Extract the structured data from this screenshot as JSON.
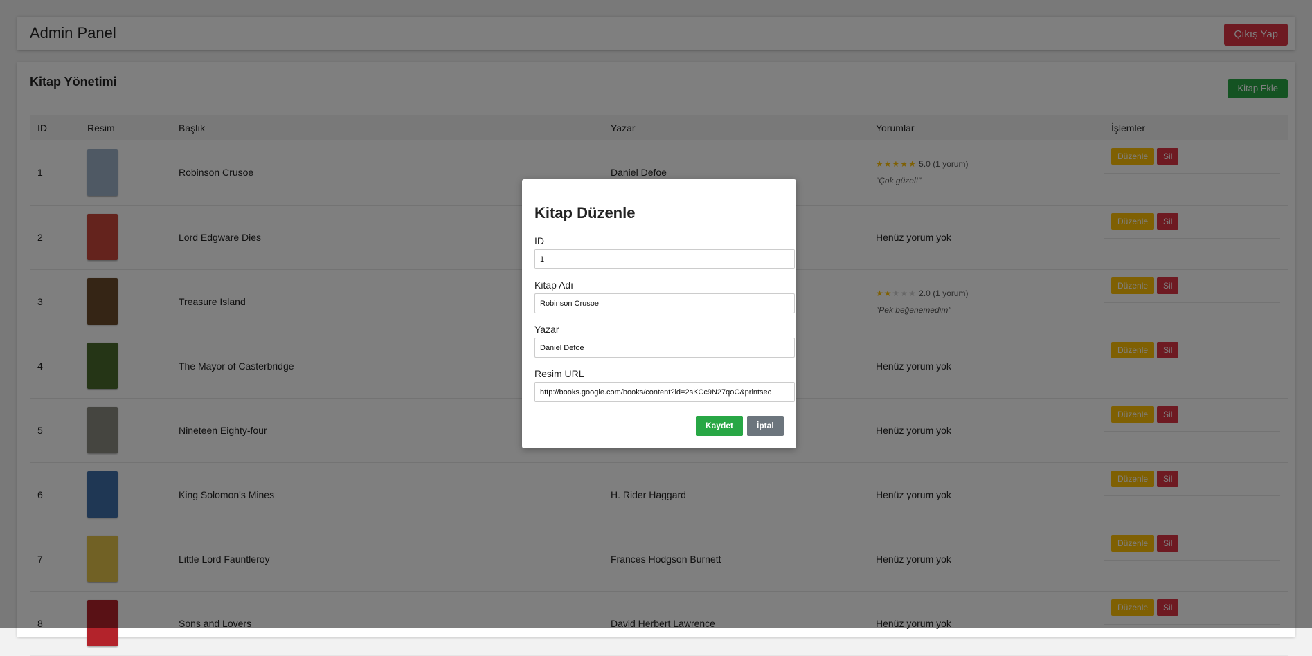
{
  "header": {
    "title": "Admin Panel",
    "logout_label": "Çıkış Yap"
  },
  "panel": {
    "title": "Kitap Yönetimi",
    "add_label": "Kitap Ekle",
    "columns": [
      "ID",
      "Resim",
      "Başlık",
      "Yazar",
      "Yorumlar",
      "İşlemler"
    ],
    "edit_label": "Düzenle",
    "delete_label": "Sil",
    "rows": [
      {
        "id": "1",
        "title": "Robinson Crusoe",
        "author": "Daniel Defoe",
        "rating": 5,
        "rating_text": "5.0 (1 yorum)",
        "comment": "\"Çok güzel!\"",
        "no_comment": "",
        "cover_color": "#9fb3c8"
      },
      {
        "id": "2",
        "title": "Lord Edgware Dies",
        "author": "",
        "rating": 0,
        "rating_text": "",
        "comment": "",
        "no_comment": "Henüz yorum yok",
        "cover_color": "#c9463a"
      },
      {
        "id": "3",
        "title": "Treasure Island",
        "author": "",
        "rating": 2,
        "rating_text": "2.0 (1 yorum)",
        "comment": "\"Pek beğenemedim\"",
        "no_comment": "",
        "cover_color": "#6b4b2a"
      },
      {
        "id": "4",
        "title": "The Mayor of Casterbridge",
        "author": "",
        "rating": 0,
        "rating_text": "",
        "comment": "",
        "no_comment": "Henüz yorum yok",
        "cover_color": "#4a6b2d"
      },
      {
        "id": "5",
        "title": "Nineteen Eighty-four",
        "author": "",
        "rating": 0,
        "rating_text": "",
        "comment": "",
        "no_comment": "Henüz yorum yok",
        "cover_color": "#8a8a80"
      },
      {
        "id": "6",
        "title": "King Solomon's Mines",
        "author": "H. Rider Haggard",
        "rating": 0,
        "rating_text": "",
        "comment": "",
        "no_comment": "Henüz yorum yok",
        "cover_color": "#3f6ea8"
      },
      {
        "id": "7",
        "title": "Little Lord Fauntleroy",
        "author": "Frances Hodgson Burnett",
        "rating": 0,
        "rating_text": "",
        "comment": "",
        "no_comment": "Henüz yorum yok",
        "cover_color": "#e2c24a"
      },
      {
        "id": "8",
        "title": "Sons and Lovers",
        "author": "David Herbert Lawrence",
        "rating": 0,
        "rating_text": "",
        "comment": "",
        "no_comment": "Henüz yorum yok",
        "cover_color": "#b3232b"
      }
    ]
  },
  "modal": {
    "title": "Kitap Düzenle",
    "id_label": "ID",
    "id_value": "1",
    "name_label": "Kitap Adı",
    "name_value": "Robinson Crusoe",
    "author_label": "Yazar",
    "author_value": "Daniel Defoe",
    "image_label": "Resim URL",
    "image_value": "http://books.google.com/books/content?id=2sKCc9N27qoC&printsec",
    "save_label": "Kaydet",
    "cancel_label": "İptal"
  },
  "colors": {
    "danger": "#dc3545",
    "success": "#28a745",
    "warning": "#ffc107",
    "secondary": "#6c757d",
    "star": "#ffc107"
  }
}
